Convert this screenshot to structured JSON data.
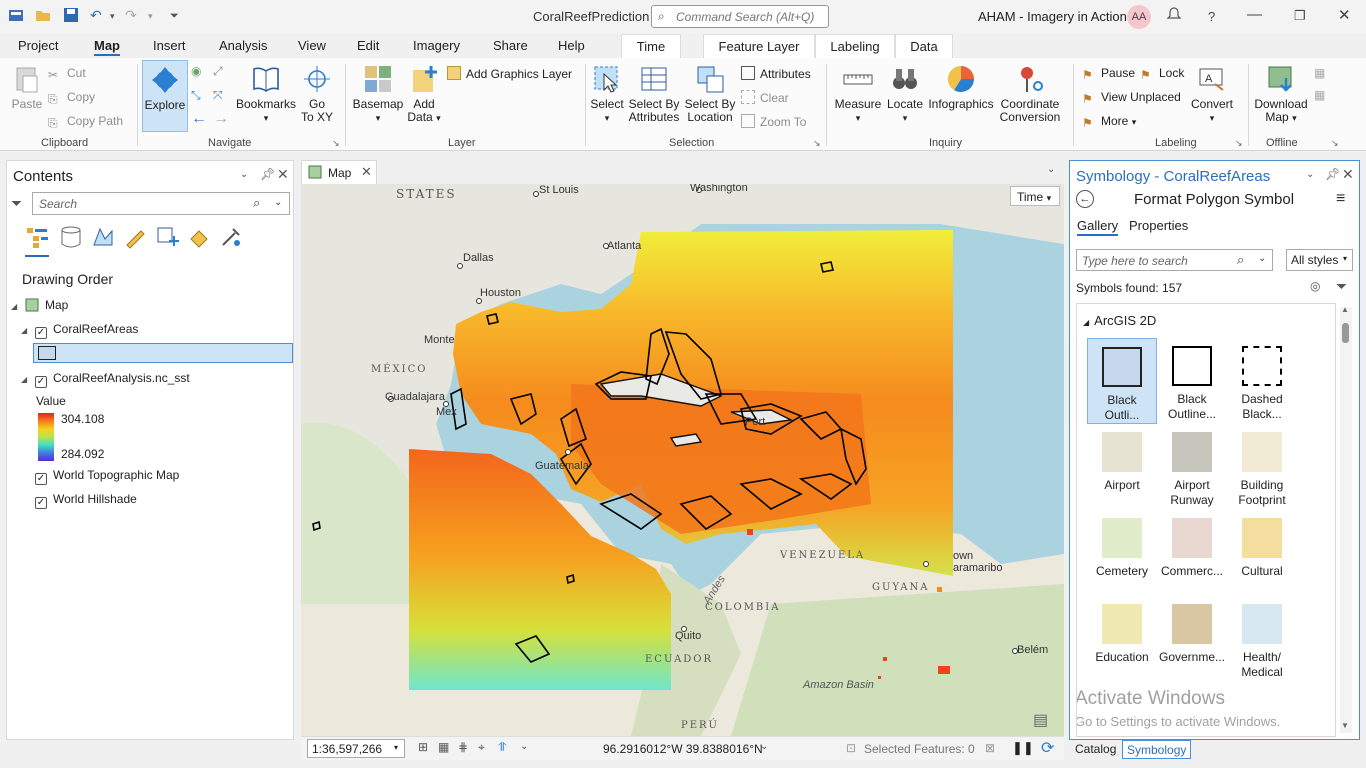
{
  "titlebar": {
    "app_title": "CoralReefPrediction",
    "command_search_placeholder": "Command Search (Alt+Q)",
    "user_name": "AHAM - Imagery in Action",
    "avatar_initials": "AA",
    "help": "?"
  },
  "tabs": [
    "Project",
    "Map",
    "Insert",
    "Analysis",
    "View",
    "Edit",
    "Imagery",
    "Share",
    "Help",
    "Time",
    "Feature Layer",
    "Labeling",
    "Data"
  ],
  "ribbon": {
    "clipboard": {
      "label": "Clipboard",
      "paste": "Paste",
      "cut": "Cut",
      "copy": "Copy",
      "copy_path": "Copy Path"
    },
    "navigate": {
      "label": "Navigate",
      "explore": "Explore",
      "bookmarks": "Bookmarks",
      "go_to_xy_1": "Go",
      "go_to_xy_2": "To XY"
    },
    "layer": {
      "label": "Layer",
      "basemap": "Basemap",
      "add_data_1": "Add",
      "add_data_2": "Data",
      "add_graphics_layer": "Add Graphics Layer"
    },
    "selection": {
      "label": "Selection",
      "select": "Select",
      "select_by_attributes_1": "Select By",
      "select_by_attributes_2": "Attributes",
      "select_by_location_1": "Select By",
      "select_by_location_2": "Location",
      "attributes": "Attributes",
      "clear": "Clear",
      "zoom_to": "Zoom To"
    },
    "inquiry": {
      "label": "Inquiry",
      "measure": "Measure",
      "locate": "Locate",
      "infographics": "Infographics",
      "coordinate_conversion_1": "Coordinate",
      "coordinate_conversion_2": "Conversion"
    },
    "labeling": {
      "label": "Labeling",
      "pause": "Pause",
      "lock": "Lock",
      "view_unplaced": "View Unplaced",
      "more": "More",
      "convert": "Convert"
    },
    "offline": {
      "label": "Offline",
      "download_map_1": "Download",
      "download_map_2": "Map"
    }
  },
  "contents": {
    "title": "Contents",
    "search_placeholder": "Search",
    "drawing_order": "Drawing Order",
    "map": "Map",
    "layer1": "CoralReefAreas",
    "layer2": "CoralReefAnalysis.nc_sst",
    "legend_title": "Value",
    "legend_max": "304.108",
    "legend_min": "284.092",
    "layer3": "World Topographic Map",
    "layer4": "World Hillshade"
  },
  "map_view": {
    "tab_title": "Map",
    "time_button": "Time",
    "labels": {
      "states": "STATES",
      "st_louis": "St Louis",
      "washington": "Washington",
      "atlanta": "Atlanta",
      "dallas": "Dallas",
      "houston": "Houston",
      "monterrey": "Monte",
      "mexico": "MÉXICO",
      "guadalajara": "Guadalajara",
      "mexico_city": "Mex",
      "guatemala": "Guatemala",
      "port": "Port",
      "venezuela": "VENEZUELA",
      "georgetown": "own",
      "paramaribo": "aramaribo",
      "guyana": "GUYANA",
      "andes": "Andes",
      "colombia": "COLOMBIA",
      "quito": "Quito",
      "ecuador": "ECUADOR",
      "belem": "Belém",
      "amazon_basin": "Amazon Basin",
      "peru": "PERÚ"
    }
  },
  "statusbar": {
    "scale": "1:36,597,266",
    "coordinates": "96.2916012°W 39.8388016°N",
    "selected_features": "Selected Features: 0"
  },
  "symbology": {
    "title": "Symbology - CoralReefAreas",
    "subtitle": "Format Polygon Symbol",
    "tab_gallery": "Gallery",
    "tab_properties": "Properties",
    "search_placeholder": "Type here to search",
    "styles_dropdown": "All styles",
    "symbols_found": "Symbols found: 157",
    "group": "ArcGIS 2D",
    "symbols": [
      {
        "l1": "Black",
        "l2": "Outli...",
        "fill": "#c6d9ec",
        "stroke": "#222222",
        "dash": ""
      },
      {
        "l1": "Black",
        "l2": "Outline...",
        "fill": "#ffffff",
        "stroke": "#000000",
        "dash": ""
      },
      {
        "l1": "Dashed",
        "l2": "Black...",
        "fill": "#ffffff",
        "stroke": "#000000",
        "dash": "4,3"
      },
      {
        "l1": "Airport",
        "l2": "",
        "fill": "#e6e3d3",
        "stroke": "none",
        "dash": ""
      },
      {
        "l1": "Airport",
        "l2": "Runway",
        "fill": "#c7c6bd",
        "stroke": "none",
        "dash": ""
      },
      {
        "l1": "Building",
        "l2": "Footprint",
        "fill": "#f1ead4",
        "stroke": "none",
        "dash": ""
      },
      {
        "l1": "Cemetery",
        "l2": "",
        "fill": "#e1edca",
        "stroke": "none",
        "dash": ""
      },
      {
        "l1": "Commerc...",
        "l2": "",
        "fill": "#e9d7d1",
        "stroke": "none",
        "dash": ""
      },
      {
        "l1": "Cultural",
        "l2": "",
        "fill": "#f3dd9f",
        "stroke": "none",
        "dash": ""
      },
      {
        "l1": "Education",
        "l2": "",
        "fill": "#f0e9b3",
        "stroke": "none",
        "dash": ""
      },
      {
        "l1": "Governme...",
        "l2": "",
        "fill": "#d9c6a3",
        "stroke": "none",
        "dash": ""
      },
      {
        "l1": "Health/",
        "l2": "Medical",
        "fill": "#d7e8f0",
        "stroke": "none",
        "dash": ""
      }
    ],
    "watermark_1": "Activate Windows",
    "watermark_2": "Go to Settings to activate Windows."
  },
  "bottom_tabs": {
    "catalog": "Catalog",
    "symbology": "Symbology"
  }
}
